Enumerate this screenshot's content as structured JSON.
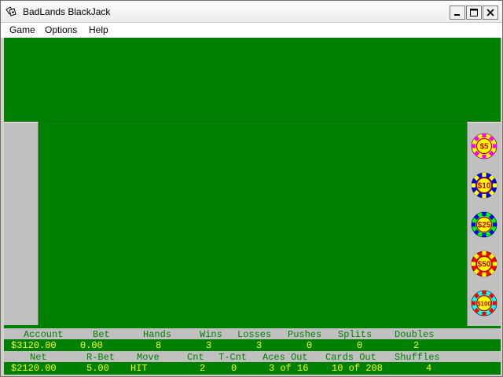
{
  "window": {
    "title": "BadLands BlackJack"
  },
  "menu": [
    "Game",
    "Options",
    "Help"
  ],
  "chips": [
    {
      "label": "$5",
      "rim": "#ffff00",
      "center": "#ffff00",
      "spot": "#ff00ff"
    },
    {
      "label": "$10",
      "rim": "#0000ff",
      "center": "#ffff00",
      "spot": "#ffff00"
    },
    {
      "label": "$25",
      "rim": "#00ff00",
      "center": "#ffff00",
      "spot": "#0000ff"
    },
    {
      "label": "$50",
      "rim": "#ff0000",
      "center": "#ffff00",
      "spot": "#ffff00"
    },
    {
      "label": "$100",
      "rim": "#00ffff",
      "center": "#ffff00",
      "spot": "#ff0000"
    }
  ],
  "stats": {
    "row1_headers": [
      "Account",
      "Bet",
      "Hands",
      "Wins",
      "Losses",
      "Pushes",
      "Splits",
      "Doubles"
    ],
    "row1_values": [
      "$3120.00",
      "0.00",
      "8",
      "3",
      "3",
      "0",
      "0",
      "2"
    ],
    "row2_headers": [
      "Net",
      "R-Bet",
      "Move",
      "Cnt",
      "T-Cnt",
      "Aces Out",
      "Cards Out",
      "Shuffles"
    ],
    "row2_values": [
      "$2120.00",
      "5.00",
      "HIT",
      "2",
      "0",
      "3 of 16",
      "10 of 208",
      "4"
    ]
  },
  "colors": {
    "felt": "#008000",
    "panel": "#c0c0c0",
    "value_text": "#ffff00",
    "header_text": "#008000"
  }
}
